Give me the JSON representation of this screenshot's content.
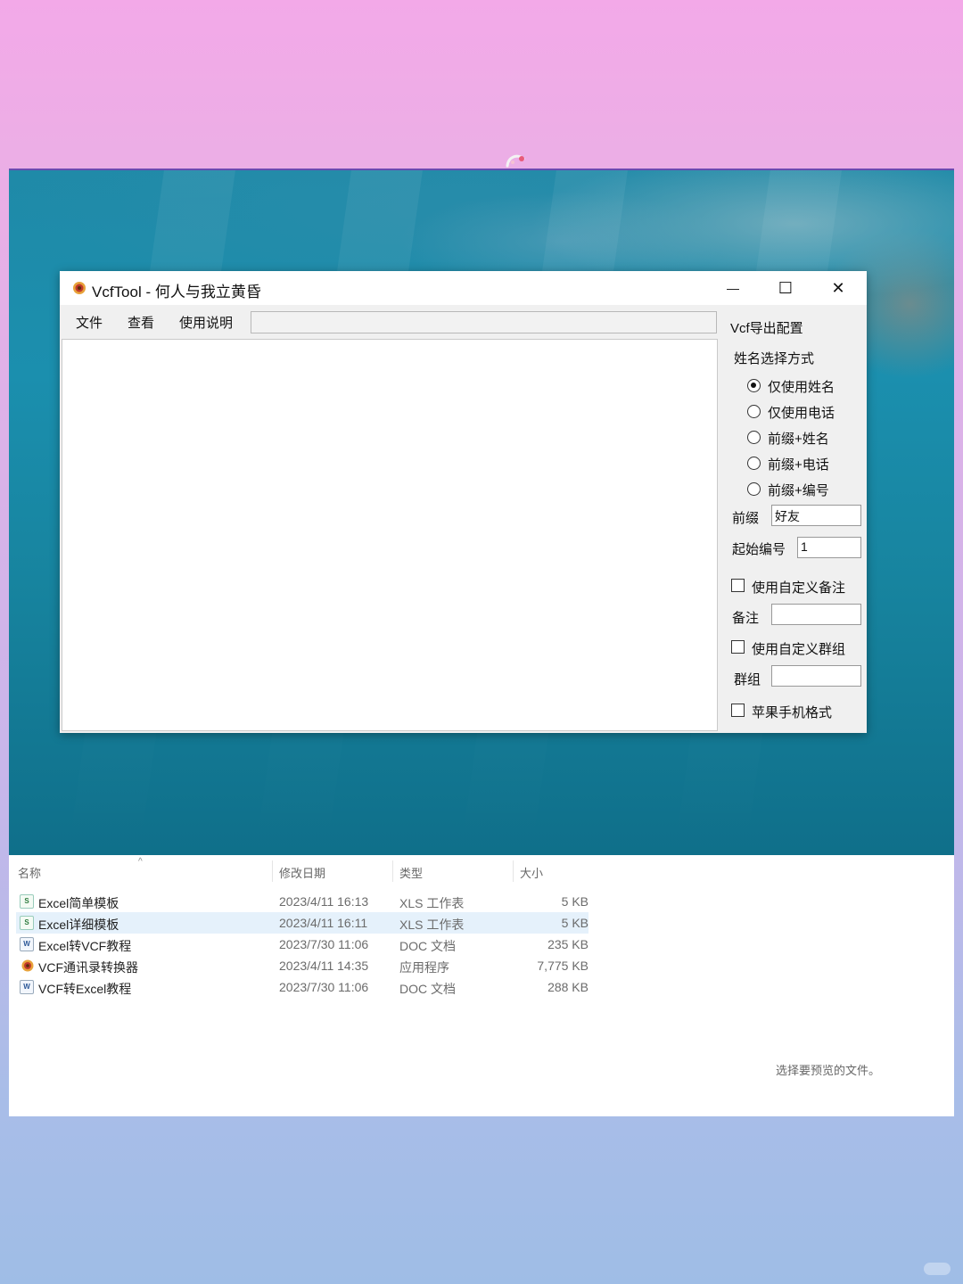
{
  "window": {
    "title": "VcfTool - 何人与我立黄昏",
    "controls": {
      "minimize": "—",
      "maximize": "☐",
      "close": "✕"
    }
  },
  "menu": {
    "file": "文件",
    "view": "查看",
    "help": "使用说明"
  },
  "path_value": "",
  "config": {
    "title": "Vcf导出配置",
    "name_mode_label": "姓名选择方式",
    "options": [
      "仅使用姓名",
      "仅使用电话",
      "前缀+姓名",
      "前缀+电话",
      "前缀+编号"
    ],
    "selected_option": "仅使用姓名",
    "prefix_label": "前缀",
    "prefix_value": "好友",
    "start_number_label": "起始编号",
    "start_number_value": "1",
    "custom_note_label": "使用自定义备注",
    "note_label": "备注",
    "note_value": "",
    "custom_group_label": "使用自定义群组",
    "group_label": "群组",
    "group_value": "",
    "apple_format_label": "苹果手机格式"
  },
  "explorer": {
    "columns": {
      "name": "名称",
      "modified": "修改日期",
      "type": "类型",
      "size": "大小"
    },
    "files": [
      {
        "name": "Excel简单模板",
        "modified": "2023/4/11 16:13",
        "type": "XLS 工作表",
        "size": "5 KB",
        "icon": "xls-icon"
      },
      {
        "name": "Excel详细模板",
        "modified": "2023/4/11 16:11",
        "type": "XLS 工作表",
        "size": "5 KB",
        "icon": "xls-icon"
      },
      {
        "name": "Excel转VCF教程",
        "modified": "2023/7/30 11:06",
        "type": "DOC 文档",
        "size": "235 KB",
        "icon": "doc-icon"
      },
      {
        "name": "VCF通讯录转换器",
        "modified": "2023/4/11 14:35",
        "type": "应用程序",
        "size": "7,775 KB",
        "icon": "app-icon"
      },
      {
        "name": "VCF转Excel教程",
        "modified": "2023/7/30 11:06",
        "type": "DOC 文档",
        "size": "288 KB",
        "icon": "doc-icon"
      }
    ],
    "selected_file": "Excel详细模板",
    "preview_hint": "选择要预览的文件。"
  },
  "colors": {
    "desktop": "#1b8fae",
    "selection": "#e5f1fb",
    "top_gradient": "#f3a9e8",
    "bottom_gradient": "#9fbde6"
  }
}
